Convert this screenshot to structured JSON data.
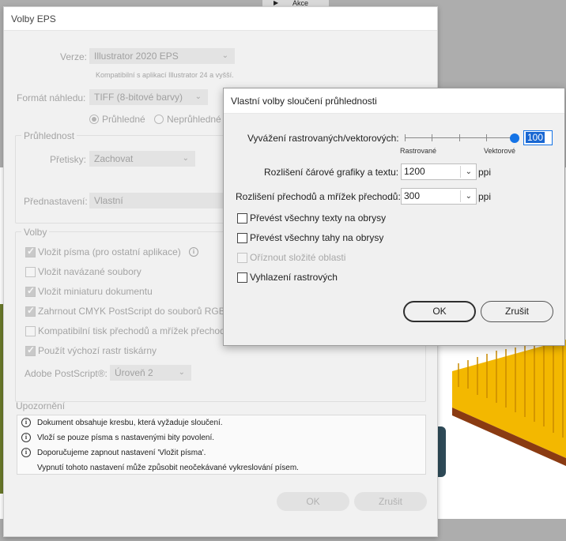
{
  "background": {
    "actions_panel_label": "Akce"
  },
  "eps_dialog": {
    "title": "Volby EPS",
    "version_label": "Verze:",
    "version_value": "Illustrator 2020 EPS",
    "compat_note": "Kompatibilní s aplikací Illustrator 24 a vyšší.",
    "preview_label": "Formát náhledu:",
    "preview_value": "TIFF (8-bitové barvy)",
    "radio_transparent": "Průhledné",
    "radio_opaque": "Neprůhledné",
    "transparency_group": "Průhlednost",
    "overprints_label": "Přetisky:",
    "overprints_value": "Zachovat",
    "preset_label": "Přednastavení:",
    "preset_value": "Vlastní",
    "options_group": "Volby",
    "options": [
      {
        "label": "Vložit písma (pro ostatní aplikace)",
        "checked": true
      },
      {
        "label": "Vložit navázané soubory",
        "checked": false
      },
      {
        "label": "Vložit miniaturu dokumentu",
        "checked": true
      },
      {
        "label": "Zahrnout CMYK PostScript do souborů RGB",
        "checked": true
      },
      {
        "label": "Kompatibilní tisk přechodů a mřížek přechodů",
        "checked": false
      },
      {
        "label": "Použít výchozí rastr tiskárny",
        "checked": true
      }
    ],
    "postscript_label": "Adobe PostScript®:",
    "postscript_value": "Úroveň 2",
    "warnings_label": "Upozornění",
    "warnings": [
      "Dokument obsahuje kresbu, která vyžaduje sloučení.",
      "Vloží se pouze písma s nastavenými bity povolení.",
      "Doporučujeme zapnout nastavení 'Vložit písma'.",
      "Vypnutí tohoto nastavení může způsobit neočekávané vykreslování písem."
    ],
    "ok_label": "OK",
    "cancel_label": "Zrušit"
  },
  "flattener_dialog": {
    "title": "Vlastní volby sloučení průhlednosti",
    "balance_label": "Vyvážení rastrovaných/vektorových:",
    "balance_value": "100",
    "balance_fraction": 1.0,
    "raster_caption": "Rastrované",
    "vector_caption": "Vektorové",
    "line_art_label": "Rozlišení čárové grafiky a textu:",
    "line_art_value": "1200",
    "gradient_label": "Rozlišení přechodů a mřížek přechodů:",
    "gradient_value": "300",
    "unit": "ppi",
    "checkboxes": [
      {
        "label": "Převést všechny texty na obrysy",
        "checked": false,
        "enabled": true
      },
      {
        "label": "Převést všechny tahy na obrysy",
        "checked": false,
        "enabled": true
      },
      {
        "label": "Oříznout složité oblasti",
        "checked": false,
        "enabled": false
      },
      {
        "label": "Vyhlazení rastrových",
        "checked": false,
        "enabled": true
      }
    ],
    "ok_label": "OK",
    "cancel_label": "Zrušit"
  }
}
